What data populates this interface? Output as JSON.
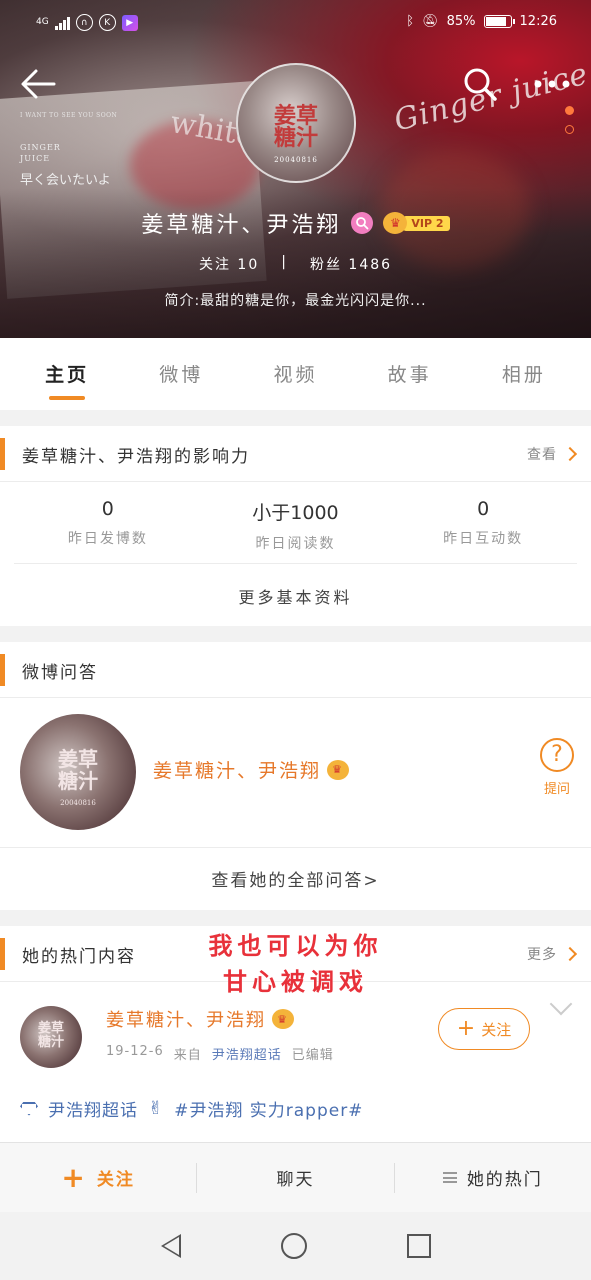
{
  "status_bar": {
    "network": "4G",
    "battery": "85%",
    "time": "12:26"
  },
  "header": {
    "photo_text": {
      "line1": "I WANT TO SEE YOU SOON",
      "line2": "GINGER",
      "line3": "JUICE",
      "line4": "早く会いたいよ",
      "word": "white",
      "script": "Ginger juice"
    },
    "avatar_logo": "姜草\n糖汁",
    "avatar_caption": "20040816",
    "username": "姜草糖汁、尹浩翔",
    "vip": "VIP 2",
    "following_label": "关注",
    "following_count": "10",
    "separator": "|",
    "followers_label": "粉丝",
    "followers_count": "1486",
    "bio": "简介:最甜的糖是你，最金光闪闪是你..."
  },
  "tabs": [
    {
      "label": "主页",
      "active": true
    },
    {
      "label": "微博",
      "active": false
    },
    {
      "label": "视频",
      "active": false
    },
    {
      "label": "故事",
      "active": false
    },
    {
      "label": "相册",
      "active": false
    }
  ],
  "influence": {
    "title": "姜草糖汁、尹浩翔的影响力",
    "link": "查看",
    "metrics": [
      {
        "value": "0",
        "label": "昨日发博数"
      },
      {
        "value": "小于1000",
        "label": "昨日阅读数"
      },
      {
        "value": "0",
        "label": "昨日互动数"
      }
    ],
    "more": "更多基本资料"
  },
  "qa": {
    "title": "微博问答",
    "name": "姜草糖汁、尹浩翔",
    "ask_label": "提问",
    "view_all": "查看她的全部问答>"
  },
  "hot": {
    "title": "她的热门内容",
    "link": "更多",
    "overlay_line1": "我也可以为你",
    "overlay_line2": "甘心被调戏",
    "post": {
      "author": "姜草糖汁、尹浩翔",
      "date": "19-12-6",
      "source_prefix": "来自",
      "source": "尹浩翔超话",
      "edited": "已编辑",
      "follow": "关注",
      "tag1": "尹浩翔超话",
      "tag2": "#尹浩翔 实力rapper#"
    }
  },
  "bottom_bar": {
    "follow": "关注",
    "chat": "聊天",
    "hot": "她的热门"
  },
  "colors": {
    "accent": "#f08a24",
    "name_orange": "#e6782a",
    "link_blue": "#4a6fb0",
    "overlay_red": "#e8313a"
  }
}
